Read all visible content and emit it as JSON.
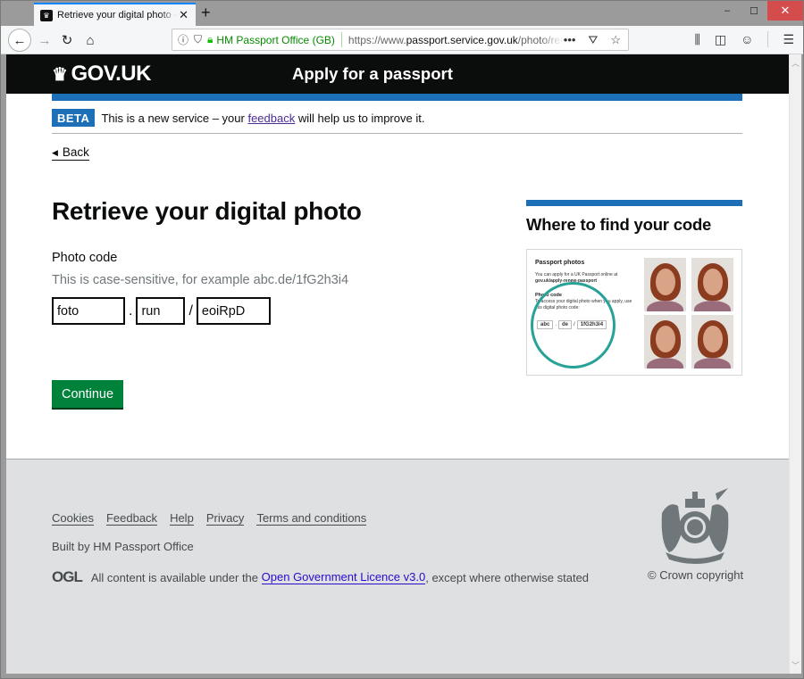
{
  "browser": {
    "tab_title": "Retrieve your digital photo – Apply for a passport",
    "tab_close": "✕",
    "new_tab": "+",
    "window_minimize": "–",
    "window_maximize": "☐",
    "window_close": "✕",
    "org_name": "HM Passport Office (GB)",
    "url_prefix": "https://www.",
    "url_domain": "passport.service.gov.uk",
    "url_path": "/photo/retrieve",
    "page_actions": "•••"
  },
  "header": {
    "logo_text": "GOV.UK",
    "service_name": "Apply for a passport"
  },
  "phase_banner": {
    "tag": "BETA",
    "text_before": "This is a new service – your ",
    "link": "feedback",
    "text_after": " will help us to improve it."
  },
  "back_link": "Back",
  "main": {
    "title": "Retrieve your digital photo",
    "field_label": "Photo code",
    "hint": "This is case-sensitive, for example abc.de/1fG2h3i4",
    "code_part1": "foto",
    "separator1": ".",
    "code_part2": "run",
    "separator2": "/",
    "code_part3": "eoiRpD",
    "continue_button": "Continue"
  },
  "aside": {
    "title": "Where to find your code",
    "example": {
      "heading": "Passport photos",
      "text1": "You can apply for a UK Passport online at",
      "text1_link": "gov.uk/apply-renew-passport",
      "photo_code_label": "Photo code",
      "text2": "To access your digital photo when you apply, use this digital photo code:",
      "code1": "abc",
      "code_sep1": ".",
      "code2": "de",
      "code_sep2": "/",
      "code3": "1fG2h3i4"
    },
    "highlight_color": "#28a197"
  },
  "footer": {
    "links": [
      "Cookies",
      "Feedback",
      "Help",
      "Privacy",
      "Terms and conditions"
    ],
    "built_by": "Built by HM Passport Office",
    "ogl_logo": "OGL",
    "licence_before": "All content is available under the ",
    "licence_link": "Open Government Licence v3.0",
    "licence_after": ", except where otherwise stated",
    "copyright": "© Crown copyright"
  },
  "colors": {
    "header_bg": "#0b0c0c",
    "brand_blue": "#1d70b8",
    "button_green": "#00823b",
    "footer_bg": "#dee0e2",
    "visited_link": "#4c2c92"
  }
}
